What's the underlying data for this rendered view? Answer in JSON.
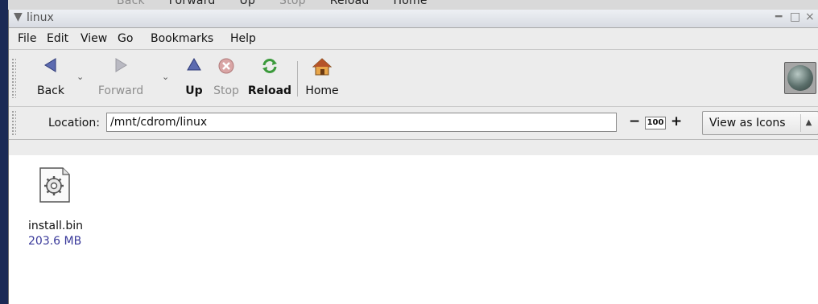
{
  "background_window": {
    "labels": [
      "Back",
      "Forward",
      "Up",
      "Stop",
      "Reload",
      "Home"
    ]
  },
  "window": {
    "title": "linux"
  },
  "menubar": {
    "items": [
      {
        "label": "File"
      },
      {
        "label": "Edit"
      },
      {
        "label": "View"
      },
      {
        "label": "Go"
      },
      {
        "label": "Bookmarks"
      },
      {
        "label": "Help"
      }
    ]
  },
  "toolbar": {
    "back": {
      "label": "Back",
      "icon": "back-arrow-icon",
      "enabled": true
    },
    "forward": {
      "label": "Forward",
      "icon": "forward-arrow-icon",
      "enabled": false
    },
    "up": {
      "label": "Up",
      "icon": "up-arrow-icon",
      "enabled": true
    },
    "stop": {
      "label": "Stop",
      "icon": "stop-icon",
      "enabled": false
    },
    "reload": {
      "label": "Reload",
      "icon": "reload-icon",
      "enabled": true
    },
    "home": {
      "label": "Home",
      "icon": "home-icon",
      "enabled": true
    }
  },
  "location": {
    "label": "Location:",
    "value": "/mnt/cdrom/linux"
  },
  "zoom": {
    "value": "100"
  },
  "view": {
    "selected": "View as Icons"
  },
  "files": [
    {
      "name": "install.bin",
      "size": "203.6 MB",
      "icon": "executable-gear-icon"
    }
  ],
  "colors": {
    "window_bg": "#ececec",
    "content_bg": "#ffffff",
    "file_size_text": "#39399a",
    "desktop": "#1b2a55"
  }
}
